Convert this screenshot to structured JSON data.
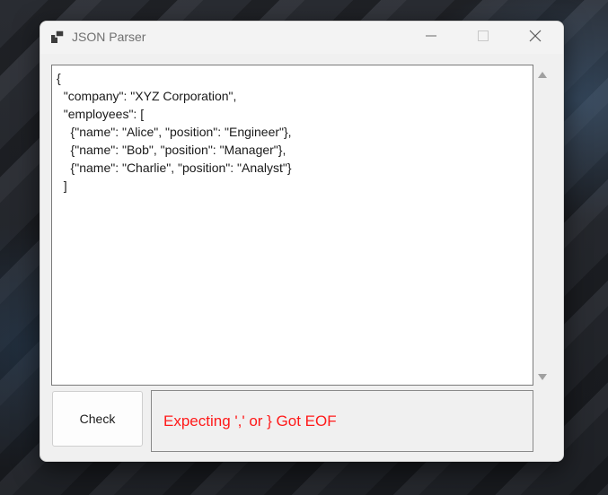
{
  "window": {
    "title": "JSON Parser",
    "controls": {
      "minimize_icon": "minimize-icon",
      "maximize_icon": "maximize-icon",
      "close_icon": "close-icon"
    }
  },
  "editor": {
    "content": "{\n  \"company\": \"XYZ Corporation\",\n  \"employees\": [\n    {\"name\": \"Alice\", \"position\": \"Engineer\"},\n    {\"name\": \"Bob\", \"position\": \"Manager\"},\n    {\"name\": \"Charlie\", \"position\": \"Analyst\"}\n  ]"
  },
  "actions": {
    "check_label": "Check"
  },
  "status": {
    "message": "Expecting ',' or } Got EOF",
    "color": "#ff1a1a"
  },
  "colors": {
    "window_bg": "#f0f0f0",
    "editor_bg": "#ffffff",
    "error_text": "#ff1a1a"
  }
}
